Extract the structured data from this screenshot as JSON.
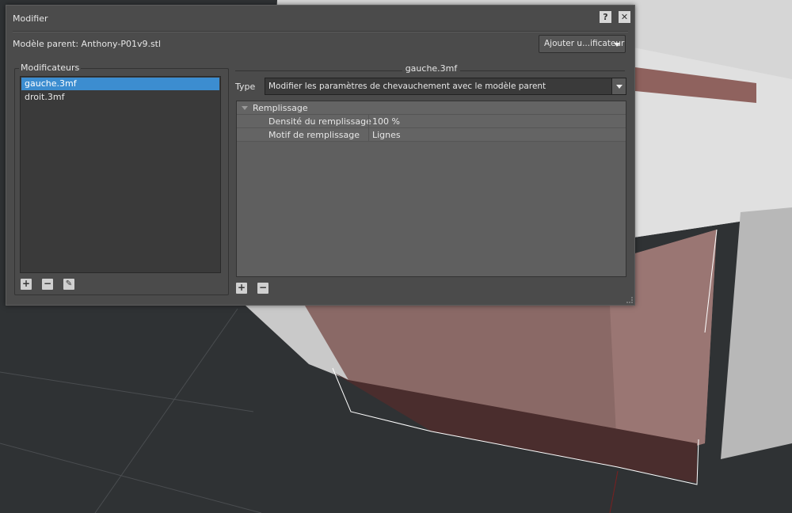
{
  "dialog": {
    "title": "Modifier",
    "help_label": "?",
    "close_label": "✕",
    "parent_model": "Modèle parent: Anthony-P01v9.stl",
    "add_modifier": "Ajouter u...ificateur"
  },
  "modifiers": {
    "group_label": "Modificateurs",
    "items": [
      {
        "label": "gauche.3mf",
        "selected": true
      },
      {
        "label": "droit.3mf",
        "selected": false
      }
    ]
  },
  "details": {
    "title": "gauche.3mf",
    "type_label": "Type",
    "type_value": "Modifier les paramètres de chevauchement avec le modèle parent",
    "category": "Remplissage",
    "settings": [
      {
        "key": "Densité du remplissage",
        "value": "100 %"
      },
      {
        "key": "Motif de remplissage",
        "value": "Lignes"
      }
    ]
  },
  "colors": {
    "accent": "#3c8dd0",
    "model": "#9b7470"
  }
}
